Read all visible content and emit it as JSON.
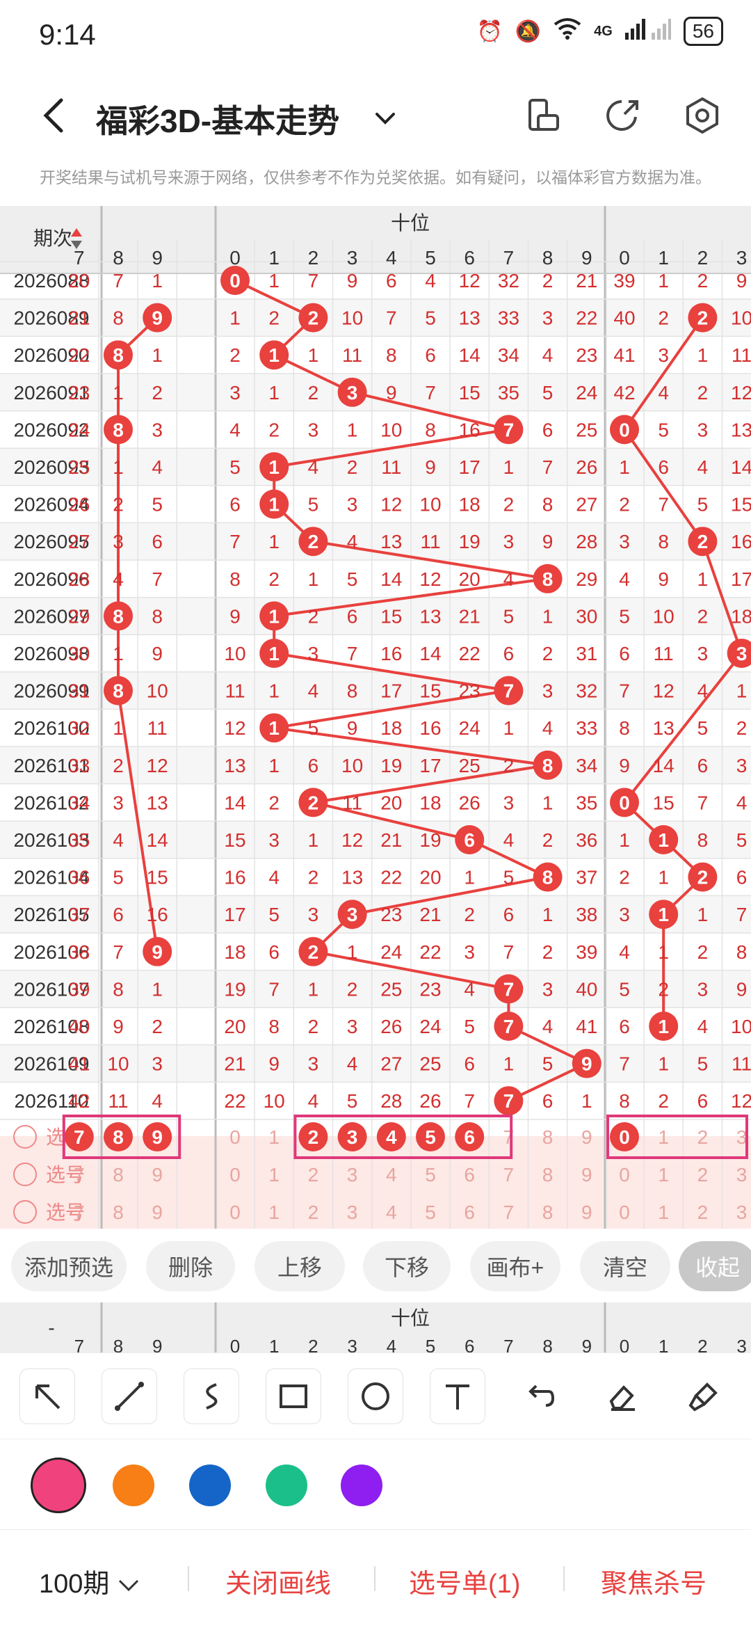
{
  "status_bar": {
    "time": "9:14",
    "network": "4G",
    "battery": "56"
  },
  "header": {
    "title": "福彩3D-基本走势"
  },
  "notice": "开奖结果与试机号来源于网络，仅供参考不作为兑奖依据。如有疑问，以福体彩官方数据为准。",
  "grid": {
    "period_header": "期次",
    "section_label": "十位",
    "left_digits": [
      "7",
      "8",
      "9"
    ],
    "tens_digits": [
      "0",
      "1",
      "2",
      "3",
      "4",
      "5",
      "6",
      "7",
      "8",
      "9"
    ],
    "right_digits": [
      "0",
      "1",
      "2",
      "3"
    ],
    "select_label": "选号",
    "rows": [
      {
        "p": "2026088",
        "l": [
          "20",
          "7",
          "1"
        ],
        "t": [
          "0",
          "1",
          "7",
          "9",
          "6",
          "4",
          "12",
          "32",
          "2",
          "21"
        ],
        "r": [
          "39",
          "1",
          "2",
          "9"
        ],
        "lh": -1,
        "th": 0,
        "rh": -1
      },
      {
        "p": "2026089",
        "l": [
          "21",
          "8",
          "9"
        ],
        "t": [
          "1",
          "2",
          "2",
          "10",
          "7",
          "5",
          "13",
          "33",
          "3",
          "22"
        ],
        "r": [
          "40",
          "2",
          "2",
          "10"
        ],
        "lh": 2,
        "th": 2,
        "rh": 2
      },
      {
        "p": "2026090",
        "l": [
          "22",
          "8",
          "1"
        ],
        "t": [
          "2",
          "1",
          "1",
          "11",
          "8",
          "6",
          "14",
          "34",
          "4",
          "23"
        ],
        "r": [
          "41",
          "3",
          "1",
          "11"
        ],
        "lh": 1,
        "th": 1,
        "rh": -1
      },
      {
        "p": "2026091",
        "l": [
          "23",
          "1",
          "2"
        ],
        "t": [
          "3",
          "1",
          "2",
          "3",
          "9",
          "7",
          "15",
          "35",
          "5",
          "24"
        ],
        "r": [
          "42",
          "4",
          "2",
          "12"
        ],
        "lh": -1,
        "th": 3,
        "rh": -1
      },
      {
        "p": "2026092",
        "l": [
          "24",
          "8",
          "3"
        ],
        "t": [
          "4",
          "2",
          "3",
          "1",
          "10",
          "8",
          "16",
          "7",
          "6",
          "25"
        ],
        "r": [
          "0",
          "5",
          "3",
          "13"
        ],
        "lh": 1,
        "th": 7,
        "rh": 0
      },
      {
        "p": "2026093",
        "l": [
          "25",
          "1",
          "4"
        ],
        "t": [
          "5",
          "1",
          "4",
          "2",
          "11",
          "9",
          "17",
          "1",
          "7",
          "26"
        ],
        "r": [
          "1",
          "6",
          "4",
          "14"
        ],
        "lh": -1,
        "th": 1,
        "rh": -1
      },
      {
        "p": "2026094",
        "l": [
          "26",
          "2",
          "5"
        ],
        "t": [
          "6",
          "1",
          "5",
          "3",
          "12",
          "10",
          "18",
          "2",
          "8",
          "27"
        ],
        "r": [
          "2",
          "7",
          "5",
          "15"
        ],
        "lh": -1,
        "th": 1,
        "rh": -1
      },
      {
        "p": "2026095",
        "l": [
          "27",
          "3",
          "6"
        ],
        "t": [
          "7",
          "1",
          "2",
          "4",
          "13",
          "11",
          "19",
          "3",
          "9",
          "28"
        ],
        "r": [
          "3",
          "8",
          "2",
          "16"
        ],
        "lh": -1,
        "th": 2,
        "rh": 2
      },
      {
        "p": "2026096",
        "l": [
          "28",
          "4",
          "7"
        ],
        "t": [
          "8",
          "2",
          "1",
          "5",
          "14",
          "12",
          "20",
          "4",
          "8",
          "29"
        ],
        "r": [
          "4",
          "9",
          "1",
          "17"
        ],
        "lh": -1,
        "th": 8,
        "rh": -1
      },
      {
        "p": "2026097",
        "l": [
          "29",
          "8",
          "8"
        ],
        "t": [
          "9",
          "1",
          "2",
          "6",
          "15",
          "13",
          "21",
          "5",
          "1",
          "30"
        ],
        "r": [
          "5",
          "10",
          "2",
          "18"
        ],
        "lh": 1,
        "th": 1,
        "rh": -1
      },
      {
        "p": "2026098",
        "l": [
          "30",
          "1",
          "9"
        ],
        "t": [
          "10",
          "1",
          "3",
          "7",
          "16",
          "14",
          "22",
          "6",
          "2",
          "31"
        ],
        "r": [
          "6",
          "11",
          "3",
          "3"
        ],
        "lh": -1,
        "th": 1,
        "rh": 3
      },
      {
        "p": "2026099",
        "l": [
          "31",
          "8",
          "10"
        ],
        "t": [
          "11",
          "1",
          "4",
          "8",
          "17",
          "15",
          "23",
          "7",
          "3",
          "32"
        ],
        "r": [
          "7",
          "12",
          "4",
          "1"
        ],
        "lh": 1,
        "th": 7,
        "rh": -1
      },
      {
        "p": "2026100",
        "l": [
          "32",
          "1",
          "11"
        ],
        "t": [
          "12",
          "1",
          "5",
          "9",
          "18",
          "16",
          "24",
          "1",
          "4",
          "33"
        ],
        "r": [
          "8",
          "13",
          "5",
          "2"
        ],
        "lh": -1,
        "th": 1,
        "rh": -1
      },
      {
        "p": "2026101",
        "l": [
          "33",
          "2",
          "12"
        ],
        "t": [
          "13",
          "1",
          "6",
          "10",
          "19",
          "17",
          "25",
          "2",
          "8",
          "34"
        ],
        "r": [
          "9",
          "14",
          "6",
          "3"
        ],
        "lh": -1,
        "th": 8,
        "rh": -1
      },
      {
        "p": "2026102",
        "l": [
          "34",
          "3",
          "13"
        ],
        "t": [
          "14",
          "2",
          "2",
          "11",
          "20",
          "18",
          "26",
          "3",
          "1",
          "35"
        ],
        "r": [
          "0",
          "15",
          "7",
          "4"
        ],
        "lh": -1,
        "th": 2,
        "rh": 0
      },
      {
        "p": "2026103",
        "l": [
          "35",
          "4",
          "14"
        ],
        "t": [
          "15",
          "3",
          "1",
          "12",
          "21",
          "19",
          "6",
          "4",
          "2",
          "36"
        ],
        "r": [
          "1",
          "1",
          "8",
          "5"
        ],
        "lh": -1,
        "th": 6,
        "rh": 1
      },
      {
        "p": "2026104",
        "l": [
          "36",
          "5",
          "15"
        ],
        "t": [
          "16",
          "4",
          "2",
          "13",
          "22",
          "20",
          "1",
          "5",
          "8",
          "37"
        ],
        "r": [
          "2",
          "1",
          "2",
          "6"
        ],
        "lh": -1,
        "th": 8,
        "rh": 2
      },
      {
        "p": "2026105",
        "l": [
          "37",
          "6",
          "16"
        ],
        "t": [
          "17",
          "5",
          "3",
          "3",
          "23",
          "21",
          "2",
          "6",
          "1",
          "38"
        ],
        "r": [
          "3",
          "1",
          "1",
          "7"
        ],
        "lh": -1,
        "th": 3,
        "rh": 1
      },
      {
        "p": "2026106",
        "l": [
          "38",
          "7",
          "9"
        ],
        "t": [
          "18",
          "6",
          "2",
          "1",
          "24",
          "22",
          "3",
          "7",
          "2",
          "39"
        ],
        "r": [
          "4",
          "1",
          "2",
          "8"
        ],
        "lh": 2,
        "th": 2,
        "rh": -1
      },
      {
        "p": "2026107",
        "l": [
          "39",
          "8",
          "1"
        ],
        "t": [
          "19",
          "7",
          "1",
          "2",
          "25",
          "23",
          "4",
          "7",
          "3",
          "40"
        ],
        "r": [
          "5",
          "2",
          "3",
          "9"
        ],
        "lh": -1,
        "th": 7,
        "rh": -1
      },
      {
        "p": "2026108",
        "l": [
          "40",
          "9",
          "2"
        ],
        "t": [
          "20",
          "8",
          "2",
          "3",
          "26",
          "24",
          "5",
          "7",
          "4",
          "41"
        ],
        "r": [
          "6",
          "1",
          "4",
          "10"
        ],
        "lh": -1,
        "th": 7,
        "rh": 1
      },
      {
        "p": "2026109",
        "l": [
          "41",
          "10",
          "3"
        ],
        "t": [
          "21",
          "9",
          "3",
          "4",
          "27",
          "25",
          "6",
          "1",
          "5",
          "9"
        ],
        "r": [
          "7",
          "1",
          "5",
          "11"
        ],
        "lh": -1,
        "th": 9,
        "rh": -1
      },
      {
        "p": "2026110",
        "l": [
          "42",
          "11",
          "4"
        ],
        "t": [
          "22",
          "10",
          "4",
          "5",
          "28",
          "26",
          "7",
          "7",
          "6",
          "1"
        ],
        "r": [
          "8",
          "2",
          "6",
          "12"
        ],
        "lh": -1,
        "th": 7,
        "rh": -1
      }
    ],
    "selected_left": [
      0,
      1,
      2
    ],
    "selected_tens": [
      2,
      3,
      4,
      5,
      6
    ],
    "selected_right": [
      0
    ]
  },
  "actions": {
    "add": "添加预选",
    "delete": "删除",
    "up": "上移",
    "down": "下移",
    "canvas": "画布+",
    "clear": "清空",
    "collapse": "收起"
  },
  "mini_header": {
    "period": "-",
    "section": "十位"
  },
  "draw_tools": [
    "arrow-icon",
    "line-icon",
    "curve-icon",
    "rectangle-icon",
    "circle-icon",
    "text-icon",
    "undo-icon",
    "eraser-icon",
    "clear-brush-icon"
  ],
  "palette": [
    "#f0437d",
    "#f77f16",
    "#1565c8",
    "#1bbf8a",
    "#8e1ff0"
  ],
  "bottom": {
    "period": "100期",
    "close_draw": "关闭画线",
    "ticket": "选号单(1)",
    "focus": "聚焦杀号"
  },
  "colors": {
    "accent": "#e8413e",
    "pink_box": "#e0387a"
  }
}
